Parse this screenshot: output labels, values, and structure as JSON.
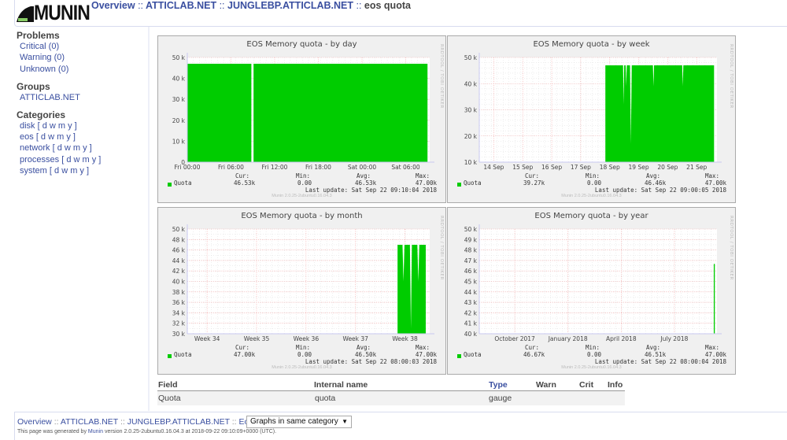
{
  "header": {
    "logo": "MUNIN",
    "crumbs": [
      "Overview",
      "ATTICLAB.NET",
      "JUNGLEBP.ATTICLAB.NET"
    ],
    "sep": "::",
    "current": "eos quota"
  },
  "sidebar": {
    "problems_title": "Problems",
    "problems": [
      "Critical (0)",
      "Warning (0)",
      "Unknown (0)"
    ],
    "groups_title": "Groups",
    "groups": [
      "ATTICLAB.NET"
    ],
    "categories_title": "Categories",
    "categories": [
      {
        "name": "disk",
        "links": "[ d w m y ]"
      },
      {
        "name": "eos",
        "links": "[ d w m y ]"
      },
      {
        "name": "network",
        "links": "[ d w m y ]"
      },
      {
        "name": "processes",
        "links": "[ d w m y ]"
      },
      {
        "name": "system",
        "links": "[ d w m y ]"
      }
    ]
  },
  "graph_common": {
    "watermark": "RRDTOOL / TOBI OETIKER",
    "version": "Munin 2.0.25-2ubuntu0.16.04.3",
    "series_name": "Quota",
    "series_color": "#00cc00",
    "cur_label": "Cur:",
    "min_label": "Min:",
    "avg_label": "Avg:",
    "max_label": "Max:"
  },
  "chart_data": [
    {
      "type": "area",
      "title": "EOS Memory quota - by day",
      "ylim": [
        0,
        50000
      ],
      "yticks": [
        0,
        10000,
        20000,
        30000,
        40000,
        50000
      ],
      "ytick_labels": [
        "0",
        "10 k",
        "20 k",
        "30 k",
        "40 k",
        "50 k"
      ],
      "xlim": [
        0,
        33.3
      ],
      "xticks": [
        0,
        6,
        12,
        18,
        24,
        30
      ],
      "xtick_labels": [
        "Fri 00:00",
        "Fri 06:00",
        "Fri 12:00",
        "Fri 18:00",
        "Sat 00:00",
        "Sat 06:00"
      ],
      "segments": [
        [
          [
            0,
            47000
          ],
          [
            8.8,
            47000
          ]
        ],
        [
          [
            9.1,
            47000
          ],
          [
            33,
            47000
          ]
        ]
      ],
      "cur": "46.53k",
      "min": "0.00",
      "avg": "46.53k",
      "max": "47.00k",
      "last_update": "Last update: Sat Sep 22 09:10:04 2018"
    },
    {
      "type": "area",
      "title": "EOS Memory quota - by week",
      "ylim": [
        10000,
        50000
      ],
      "yticks": [
        10000,
        20000,
        30000,
        40000,
        50000
      ],
      "ytick_labels": [
        "10 k",
        "20 k",
        "30 k",
        "40 k",
        "50 k"
      ],
      "xlim": [
        0,
        8.2
      ],
      "xticks": [
        0.5,
        1.5,
        2.5,
        3.5,
        4.5,
        5.5,
        6.5,
        7.5
      ],
      "xtick_labels": [
        "14 Sep",
        "15 Sep",
        "16 Sep",
        "17 Sep",
        "18 Sep",
        "19 Sep",
        "20 Sep",
        "21 Sep"
      ],
      "segments": [
        [
          [
            4.35,
            47000
          ],
          [
            4.96,
            47000
          ],
          [
            4.98,
            32000
          ],
          [
            5.0,
            47000
          ],
          [
            5.05,
            47000
          ],
          [
            5.07,
            39000
          ],
          [
            5.09,
            47000
          ],
          [
            5.2,
            47000
          ],
          [
            5.23,
            17000
          ],
          [
            5.26,
            47000
          ],
          [
            5.99,
            47000
          ],
          [
            6.01,
            39000
          ],
          [
            6.03,
            47000
          ],
          [
            7.0,
            47000
          ],
          [
            7.02,
            39000
          ],
          [
            7.04,
            47000
          ],
          [
            8.1,
            47000
          ]
        ]
      ],
      "cur": "39.27k",
      "min": "0.00",
      "avg": "46.46k",
      "max": "47.00k",
      "last_update": "Last update: Sat Sep 22 09:00:05 2018"
    },
    {
      "type": "area",
      "title": "EOS Memory quota - by month",
      "ylim": [
        30000,
        50000
      ],
      "yticks": [
        30000,
        32000,
        34000,
        36000,
        38000,
        40000,
        42000,
        44000,
        46000,
        48000,
        50000
      ],
      "ytick_labels": [
        "30 k",
        "32 k",
        "34 k",
        "36 k",
        "38 k",
        "40 k",
        "42 k",
        "44 k",
        "46 k",
        "48 k",
        "50 k"
      ],
      "xlim": [
        33.6,
        38.5
      ],
      "xticks": [
        34,
        35,
        36,
        37,
        38
      ],
      "xtick_labels": [
        "Week 34",
        "Week 35",
        "Week 36",
        "Week 37",
        "Week 38"
      ],
      "segments": [
        [
          [
            37.85,
            47000
          ],
          [
            37.95,
            47000
          ],
          [
            37.97,
            40000
          ],
          [
            37.99,
            47000
          ],
          [
            38.1,
            47000
          ],
          [
            38.12,
            31000
          ],
          [
            38.14,
            47000
          ],
          [
            38.25,
            47000
          ],
          [
            38.27,
            40000
          ],
          [
            38.29,
            47000
          ],
          [
            38.42,
            47000
          ]
        ]
      ],
      "cur": "47.00k",
      "min": "0.00",
      "avg": "46.50k",
      "max": "47.00k",
      "last_update": "Last update: Sat Sep 22 08:00:03 2018"
    },
    {
      "type": "area",
      "title": "EOS Memory quota - by year",
      "ylim": [
        40000,
        50000
      ],
      "yticks": [
        40000,
        41000,
        42000,
        43000,
        44000,
        45000,
        46000,
        47000,
        48000,
        49000,
        50000
      ],
      "ytick_labels": [
        "40 k",
        "41 k",
        "42 k",
        "43 k",
        "44 k",
        "45 k",
        "46 k",
        "47 k",
        "48 k",
        "49 k",
        "50 k"
      ],
      "xlim": [
        -2,
        11.4
      ],
      "xticks": [
        0,
        3,
        6,
        9
      ],
      "xtick_labels": [
        "October 2017",
        "January 2018",
        "April 2018",
        "July 2018"
      ],
      "segments": [
        [
          [
            11.22,
            46670
          ],
          [
            11.28,
            46670
          ]
        ]
      ],
      "cur": "46.67k",
      "min": "0.00",
      "avg": "46.51k",
      "max": "47.00k",
      "last_update": "Last update: Sat Sep 22 08:00:04 2018"
    }
  ],
  "fields_table": {
    "headers": [
      "Field",
      "Internal name",
      "Type",
      "Warn",
      "Crit",
      "Info"
    ],
    "rows": [
      [
        "Quota",
        "quota",
        "gauge",
        "",
        "",
        ""
      ]
    ]
  },
  "footer": {
    "crumbs": [
      "Overview",
      "ATTICLAB.NET",
      "JUNGLEBP.ATTICLAB.NET",
      "Eos"
    ],
    "sep": "::",
    "select_value": "Graphs in same category",
    "generated_prefix": "This page was generated by",
    "generated_link": "Munin",
    "generated_suffix": "version 2.0.25-2ubuntu0.16.04.3 at 2018-09-22 09:10:09+0000 (UTC)."
  }
}
